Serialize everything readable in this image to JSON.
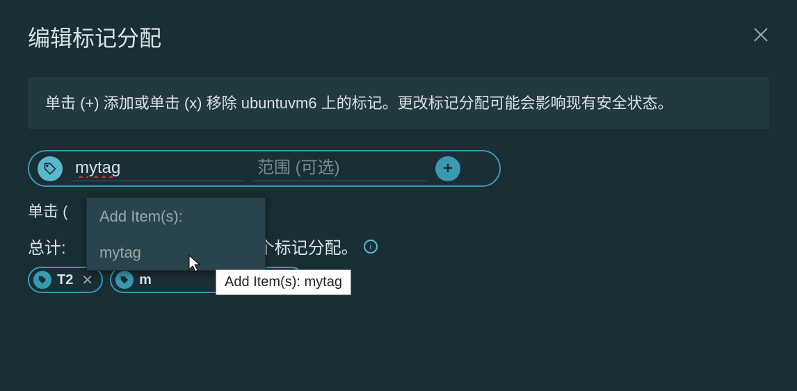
{
  "header": {
    "title": "编辑标记分配"
  },
  "banner": {
    "text": "单击 (+) 添加或单击 (x) 移除 ubuntuvm6 上的标记。更改标记分配可能会影响现有安全状态。"
  },
  "tagInput": {
    "value": "mytag",
    "scopePlaceholder": "范围 (可选)"
  },
  "hint": {
    "text": "单击 ("
  },
  "total": {
    "prefix": "总计:",
    "suffix": "个标记分配。"
  },
  "dropdown": {
    "header": "Add Item(s):",
    "item": "mytag"
  },
  "tooltip": {
    "text": "Add Item(s): mytag"
  },
  "chips": [
    {
      "label": "T2"
    },
    {
      "label": "m"
    }
  ]
}
